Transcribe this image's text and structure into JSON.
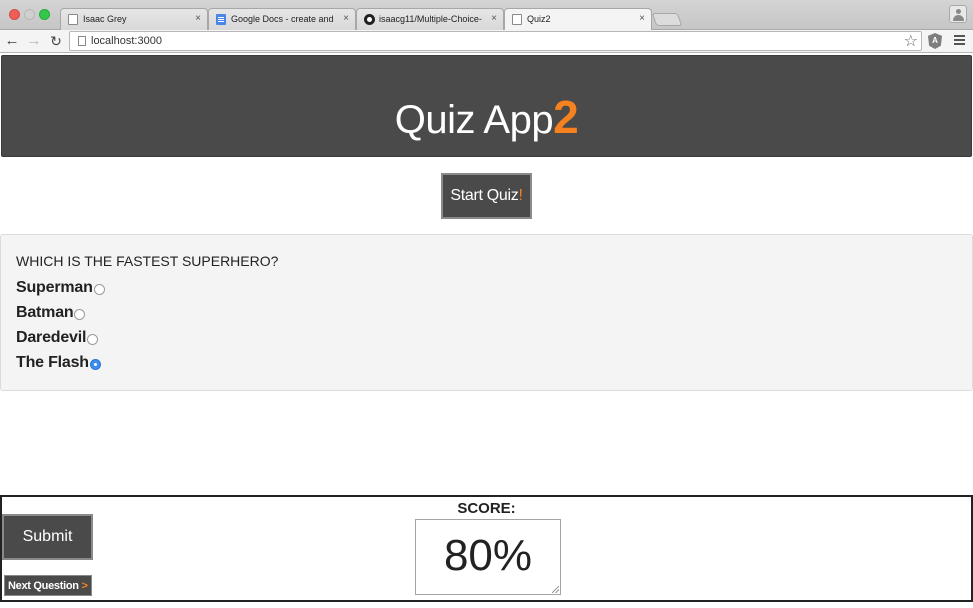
{
  "browser": {
    "tabs": [
      {
        "title": "Isaac Grey",
        "favicon": "page-icon"
      },
      {
        "title": "Google Docs - create and",
        "favicon": "google-docs-icon"
      },
      {
        "title": "isaacg11/Multiple-Choice-",
        "favicon": "github-icon"
      },
      {
        "title": "Quiz2",
        "favicon": "page-icon",
        "active": true
      }
    ],
    "close_glyph": "×",
    "url": "localhost:3000"
  },
  "header": {
    "title": "Quiz App",
    "title_accent": "2"
  },
  "start_button": {
    "label": "Start Quiz",
    "accent": "!"
  },
  "question": {
    "text": "WHICH IS THE FASTEST SUPERHERO?",
    "options": [
      {
        "label": "Superman",
        "checked": false
      },
      {
        "label": "Batman",
        "checked": false
      },
      {
        "label": "Daredevil",
        "checked": false
      },
      {
        "label": "The Flash",
        "checked": true
      }
    ]
  },
  "footer": {
    "submit_label": "Submit",
    "next_label": "Next Question",
    "next_accent": ">",
    "score_label": "SCORE:",
    "score_value": "80%"
  },
  "colors": {
    "header_bg": "#4a4a4a",
    "accent": "#f5821f",
    "radio_checked": "#3b8ff0"
  }
}
